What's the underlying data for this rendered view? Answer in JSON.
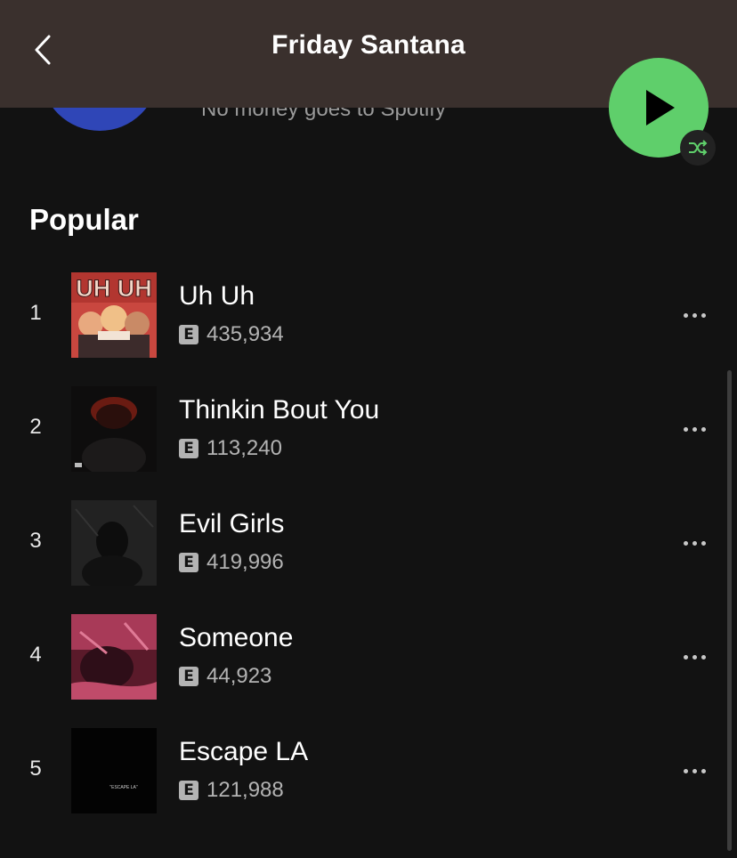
{
  "header": {
    "title": "Friday Santana",
    "back_icon": "chevron-left-icon",
    "background": "#3a302d"
  },
  "artist": {
    "support_text": "No money goes to Spotify"
  },
  "player": {
    "play_icon": "play-icon",
    "shuffle_icon": "shuffle-icon",
    "accent": "#5fcf6b"
  },
  "popular": {
    "title": "Popular",
    "tracks": [
      {
        "rank": "1",
        "name": "Uh Uh",
        "explicit": "E",
        "plays": "435,934"
      },
      {
        "rank": "2",
        "name": "Thinkin Bout You",
        "explicit": "E",
        "plays": "113,240"
      },
      {
        "rank": "3",
        "name": "Evil Girls",
        "explicit": "E",
        "plays": "419,996"
      },
      {
        "rank": "4",
        "name": "Someone",
        "explicit": "E",
        "plays": "44,923"
      },
      {
        "rank": "5",
        "name": "Escape LA",
        "explicit": "E",
        "plays": "121,988"
      }
    ]
  },
  "covers": {
    "cover_1_text": "UH UH",
    "cover_5_text": "\"ESCAPE LA\""
  }
}
